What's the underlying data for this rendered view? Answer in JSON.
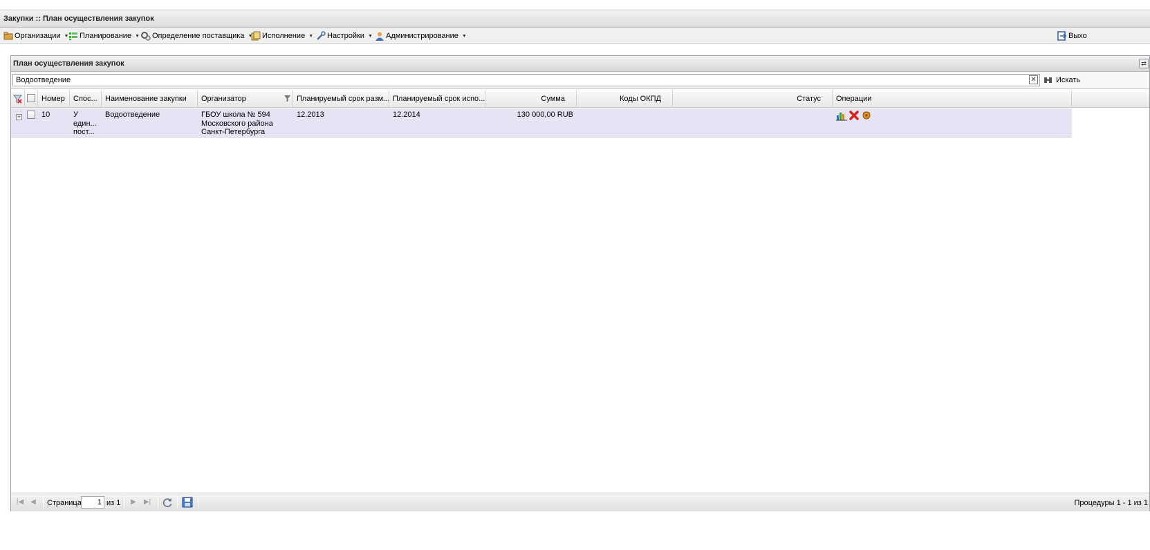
{
  "window": {
    "title": "Закупки :: План осуществления закупок"
  },
  "menu": {
    "items": [
      {
        "label": "Организации",
        "icon": "folder-icon"
      },
      {
        "label": "Планирование",
        "icon": "list-icon"
      },
      {
        "label": "Определение поставщика",
        "icon": "gears-icon"
      },
      {
        "label": "Исполнение",
        "icon": "documents-icon"
      },
      {
        "label": "Настройки",
        "icon": "wrench-icon"
      },
      {
        "label": "Администрирование",
        "icon": "user-icon"
      }
    ],
    "exit_label": "Выхо"
  },
  "panel": {
    "title": "План осуществления закупок"
  },
  "search": {
    "value": "Водоотведение",
    "button_label": "Искать"
  },
  "grid": {
    "columns": [
      "Номер",
      "Спос...",
      "Наименование закупки",
      "Организатор",
      "Планируемый срок разм...",
      "Планируемый срок испо...",
      "Сумма",
      "Коды ОКПД",
      "Статус",
      "Операции"
    ],
    "rows": [
      {
        "number": "10",
        "method": [
          "У",
          "един...",
          "пост..."
        ],
        "name": "Водоотведение",
        "organizer": [
          "ГБОУ школа № 594",
          "Московского района",
          "Санкт-Петербурга"
        ],
        "placement_date": "12.2013",
        "execution_date": "12.2014",
        "sum": "130 000,00 RUB",
        "okpd": "",
        "status": ""
      }
    ]
  },
  "pager": {
    "page_label": "Страница",
    "page_value": "1",
    "of_label": "из 1",
    "summary": "Процедуры 1 - 1 из 1"
  }
}
